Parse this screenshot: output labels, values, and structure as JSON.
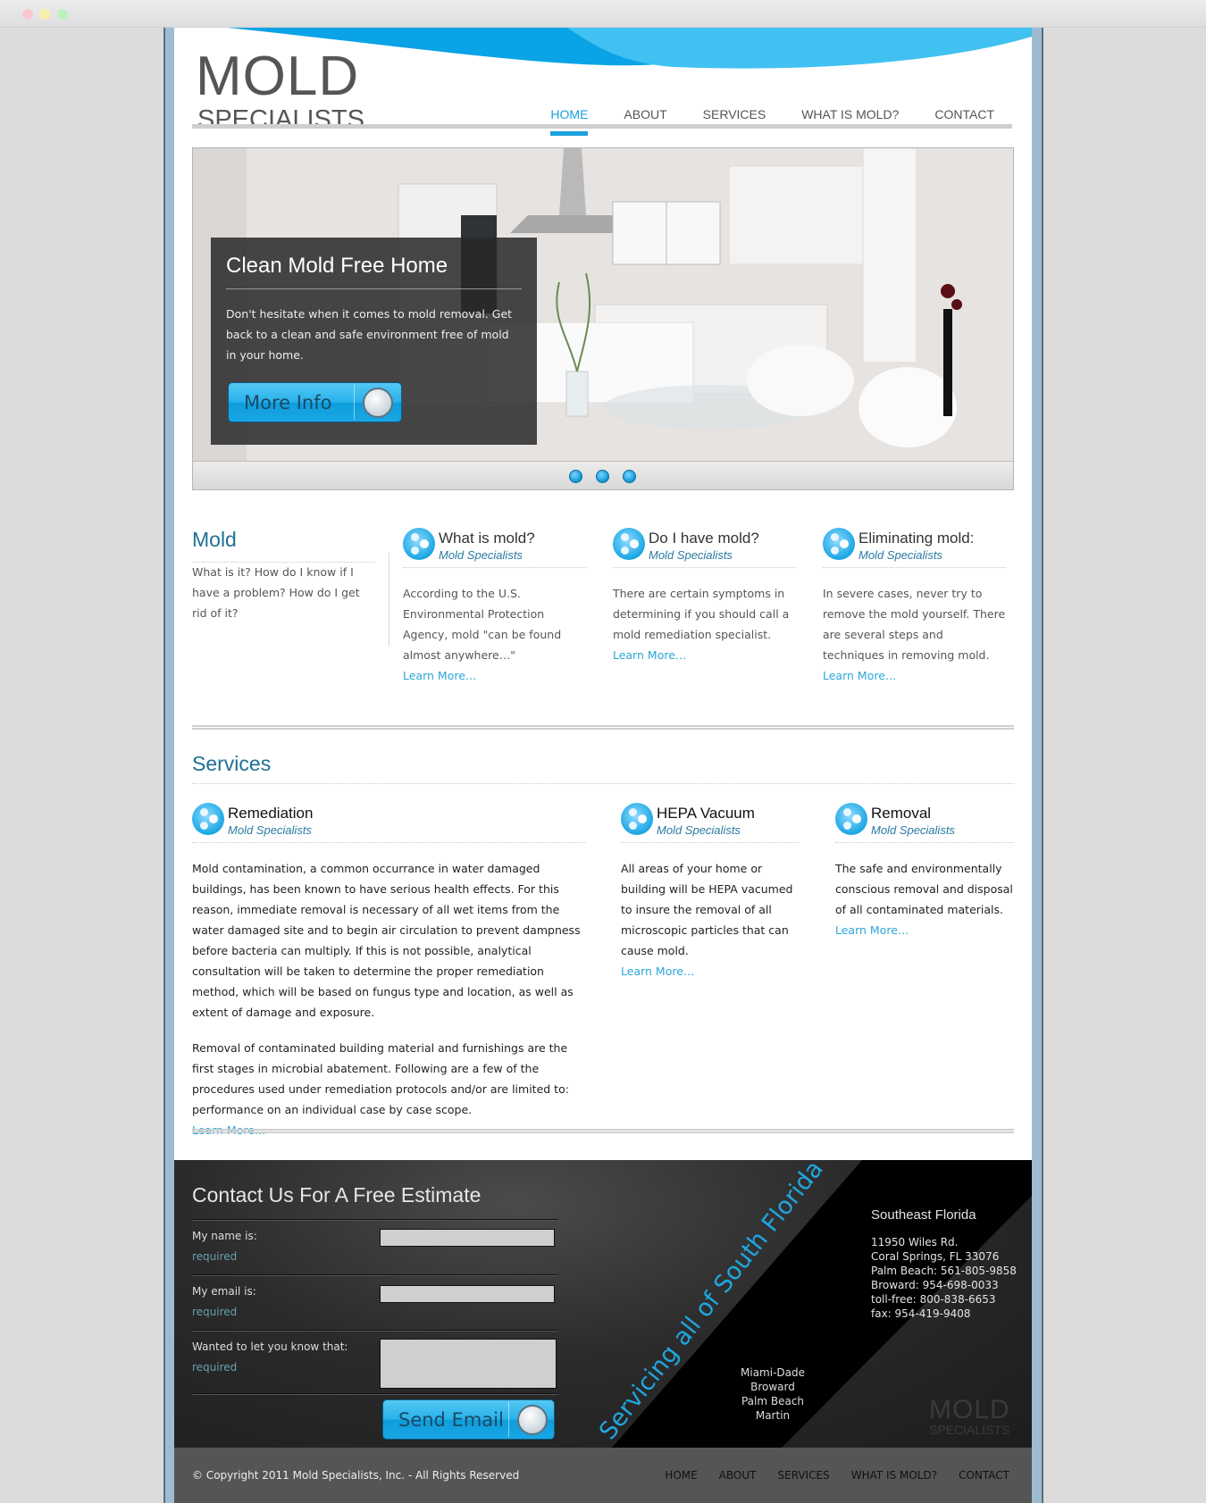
{
  "window": {
    "buttons": [
      "close",
      "minimize",
      "zoom"
    ]
  },
  "brand": {
    "logo_top": "MOLD",
    "logo_bottom": "SPECIALISTS",
    "accent_color": "#1aa0dc"
  },
  "nav": {
    "items": [
      {
        "label": "HOME",
        "active": true
      },
      {
        "label": "ABOUT",
        "active": false
      },
      {
        "label": "SERVICES",
        "active": false
      },
      {
        "label": "WHAT IS MOLD?",
        "active": false
      },
      {
        "label": "CONTACT",
        "active": false
      }
    ]
  },
  "hero": {
    "title": "Clean Mold Free Home",
    "text": "Don't hesitate when it comes to mold removal. Get back to a clean and safe environment free of mold in your home.",
    "button_label": "More Info",
    "slide_count": 3,
    "active_slide": 1
  },
  "mold_intro": {
    "title": "Mold",
    "text": "What is it? How do I know if I have a problem? How do I get rid of it?"
  },
  "features": [
    {
      "title": "What is mold?",
      "subtitle": "Mold Specialists",
      "text": "According to the U.S. Environmental Protection Agency, mold \"can be found almost anywhere…\"",
      "link": "Learn More…"
    },
    {
      "title": "Do I have mold?",
      "subtitle": "Mold Specialists",
      "text": "There are certain symptoms in determining if you should call a mold remediation specialist.",
      "link": "Learn More…"
    },
    {
      "title": "Eliminating mold:",
      "subtitle": "Mold Specialists",
      "text": "In severe cases, never try to remove the mold yourself. There are several steps and techniques in removing mold.",
      "link": "Learn More…"
    }
  ],
  "services": {
    "title": "Services",
    "items": [
      {
        "title": "Remediation",
        "subtitle": "Mold Specialists",
        "paragraphs": [
          "Mold contamination, a common occurrance in water damaged buildings, has been known to have serious health effects. For this reason, immediate removal is necessary of all wet items from the water damaged site and to begin air circulation to prevent dampness before bacteria can multiply. If this is not possible, analytical consultation will be taken to determine the proper remediation method, which will be based on fungus type and location, as well as extent of damage and exposure.",
          "Removal of contaminated building material and furnishings are the first stages in microbial abatement. Following are a few of the procedures used under remediation protocols and/or are limited to: performance on an individual case by case scope."
        ],
        "link": "Learn More…"
      },
      {
        "title": "HEPA Vacuum",
        "subtitle": "Mold Specialists",
        "paragraphs": [
          "All areas of your home or building will be HEPA vacumed to insure the removal of all microscopic particles that can cause mold."
        ],
        "link": "Learn More…"
      },
      {
        "title": "Removal",
        "subtitle": "Mold Specialists",
        "paragraphs": [
          "The safe and environmentally conscious removal and disposal of all contaminated materials."
        ],
        "link": "Learn More…"
      }
    ]
  },
  "contact": {
    "title": "Contact Us For A Free Estimate",
    "fields": [
      {
        "label": "My name is:",
        "note": "required",
        "value": "",
        "placeholder": ""
      },
      {
        "label": "My email is:",
        "note": "required",
        "value": "",
        "placeholder": ""
      },
      {
        "label": "Wanted to let you know that:",
        "note": "required",
        "value": "",
        "placeholder": ""
      }
    ],
    "submit_label": "Send Email",
    "diagonal_text": "Servicing all of South Florida",
    "areas": [
      "Miami-Dade",
      "Broward",
      "Palm Beach",
      "Martin"
    ],
    "office": {
      "heading": "Southeast Florida",
      "lines": [
        "11950 Wiles Rd.",
        "Coral Springs, FL 33076",
        "Palm Beach: 561-805-9858",
        "Broward: 954-698-0033",
        "toll-free: 800-838-6653",
        "fax: 954-419-9408"
      ]
    },
    "watermark_top": "MOLD",
    "watermark_bottom": "SPECIALISTS"
  },
  "footer": {
    "copyright": "© Copyright 2011 Mold Specialists, Inc. - All Rights Reserved",
    "nav": [
      "HOME",
      "ABOUT",
      "SERVICES",
      "WHAT IS MOLD?",
      "CONTACT"
    ]
  }
}
